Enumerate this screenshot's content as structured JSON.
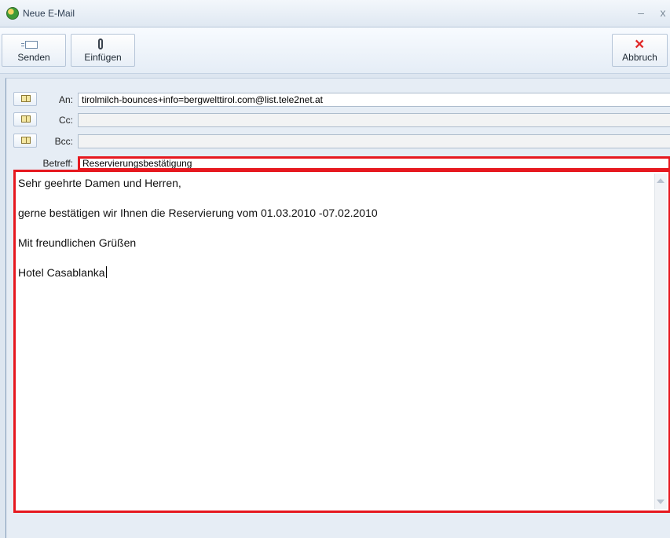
{
  "window": {
    "title": "Neue E-Mail",
    "minimize_glyph": "–",
    "close_glyph": "x"
  },
  "toolbar": {
    "send_label": "Senden",
    "attach_label": "Einfügen",
    "cancel_label": "Abbruch",
    "send_icon": "envelope-icon",
    "attach_icon": "paperclip-icon",
    "cancel_icon": "close-icon"
  },
  "fields": {
    "to_label": "An:",
    "to_value": "tirolmilch-bounces+info=bergwelttirol.com@list.tele2net.at",
    "cc_label": "Cc:",
    "cc_value": "",
    "bcc_label": "Bcc:",
    "bcc_value": "",
    "subject_label": "Betreff:",
    "subject_value": "Reservierungsbestätigung",
    "address_book_icon": "address-book-icon"
  },
  "body": {
    "lines": [
      "Sehr geehrte Damen und Herren,",
      "gerne bestätigen wir Ihnen die Reservierung vom 01.03.2010 -07.02.2010",
      "Mit freundlichen Grüßen",
      "Hotel Casablanka"
    ]
  },
  "colors": {
    "highlight_border": "#e6181f",
    "window_background": "#dde6f0"
  }
}
